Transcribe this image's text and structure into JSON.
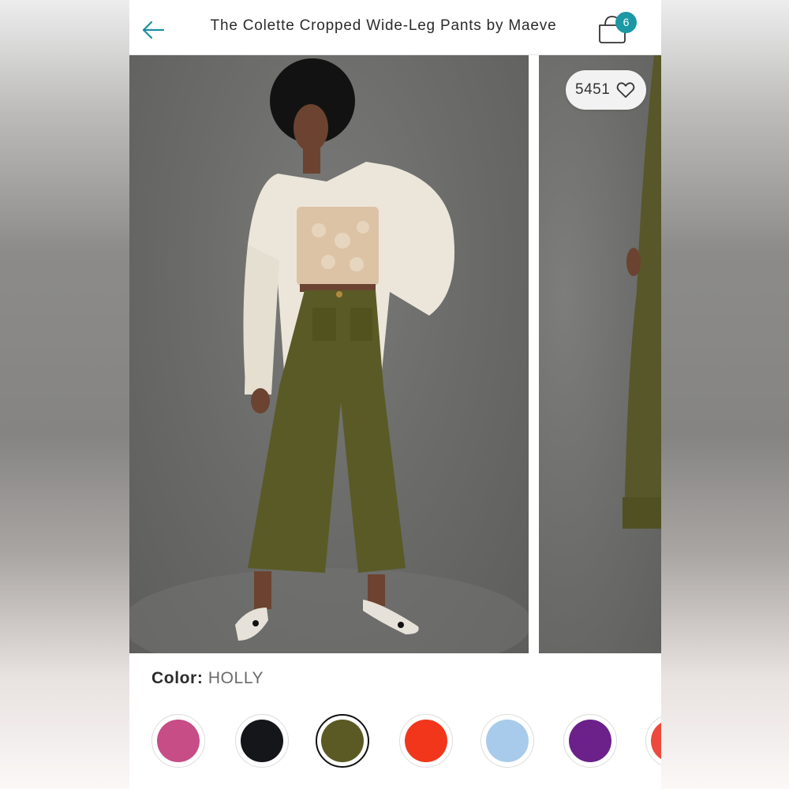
{
  "header": {
    "title": "The Colette Cropped Wide-Leg Pants by Maeve",
    "back_icon": "arrow-left-icon",
    "bag_icon": "shopping-bag-icon",
    "bag_count": "6",
    "accent_color": "#1a98a3"
  },
  "gallery": {
    "like_count": "5451",
    "like_icon": "heart-outline-icon",
    "images": [
      "model-front-photo",
      "model-side-photo"
    ]
  },
  "color": {
    "label": "Color:",
    "selected": "HOLLY"
  },
  "swatches": [
    {
      "name": "pink",
      "hex": "#c74d86",
      "selected": false
    },
    {
      "name": "black",
      "hex": "#14161a",
      "selected": false
    },
    {
      "name": "holly",
      "hex": "#5b5a24",
      "selected": true
    },
    {
      "name": "red",
      "hex": "#f1361c",
      "selected": false
    },
    {
      "name": "light-blue",
      "hex": "#a9cbeb",
      "selected": false
    },
    {
      "name": "purple",
      "hex": "#6b2189",
      "selected": false
    },
    {
      "name": "coral",
      "hex": "#ec4a3c",
      "selected": false
    }
  ]
}
